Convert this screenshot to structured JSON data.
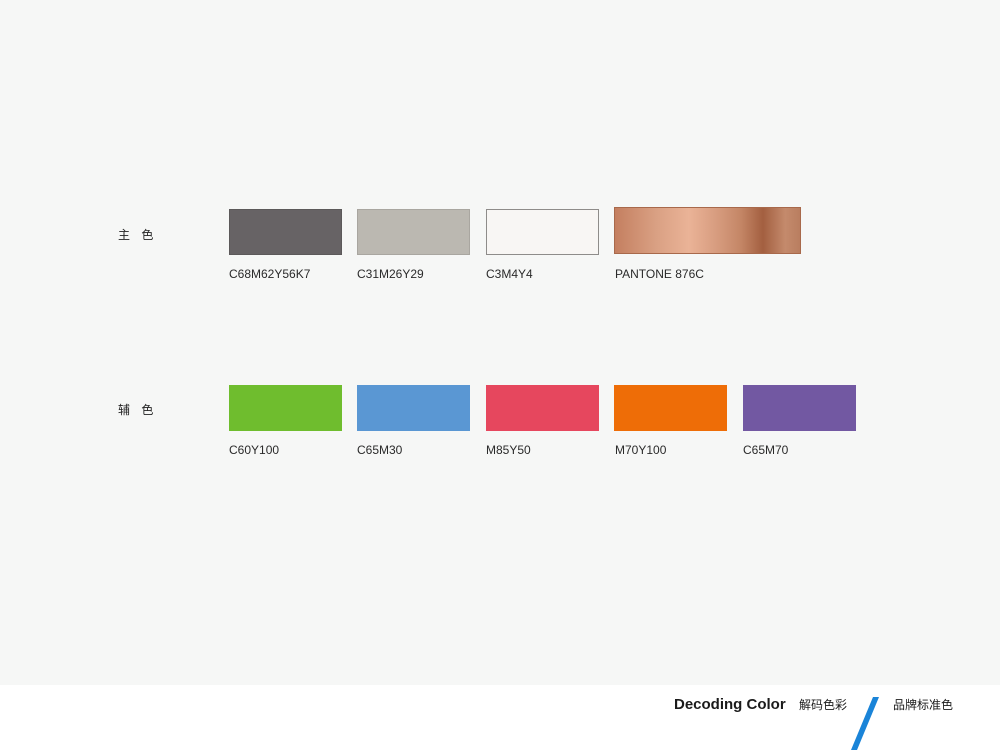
{
  "primary": {
    "label": "主 色",
    "swatches": [
      {
        "code": "C68M62Y56K7",
        "color": "#676365"
      },
      {
        "code": "C31M26Y29",
        "color": "#bbb8b1"
      },
      {
        "code": "C3M4Y4",
        "color": "#f8f6f4"
      },
      {
        "code": "PANTONE 876C",
        "color": "#c48a6c"
      }
    ]
  },
  "secondary": {
    "label": "辅 色",
    "swatches": [
      {
        "code": "C60Y100",
        "color": "#6fbd2e"
      },
      {
        "code": "C65M30",
        "color": "#5a97d3"
      },
      {
        "code": "M85Y50",
        "color": "#e6475e"
      },
      {
        "code": "M70Y100",
        "color": "#ee6d07"
      },
      {
        "code": "C65M70",
        "color": "#7258a2"
      }
    ]
  },
  "footer": {
    "title": "Decoding Color",
    "title_cn": "解码色彩",
    "section": "品牌标准色",
    "accent_color": "#1a84d8"
  }
}
